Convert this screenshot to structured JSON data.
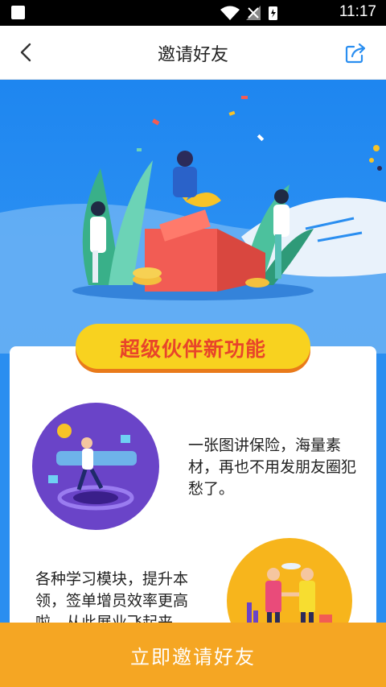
{
  "status_bar": {
    "time": "11:17"
  },
  "nav": {
    "title": "邀请好友"
  },
  "banner": {
    "label": "超级伙伴新功能"
  },
  "features": [
    {
      "text": "一张图讲保险，海量素材，再也不用发朋友圈犯愁了。"
    },
    {
      "text": "各种学习模块，提升本领，签单增员效率更高啦，从此展业飞起来"
    }
  ],
  "cta": {
    "label": "立即邀请好友"
  },
  "colors": {
    "primary_blue": "#2a8ef0",
    "cta_orange": "#f5a623",
    "banner_yellow": "#f8d21f",
    "banner_text": "#e8452a"
  },
  "icons": [
    "back-arrow-icon",
    "share-icon",
    "wifi-icon",
    "signal-icon",
    "battery-icon"
  ]
}
